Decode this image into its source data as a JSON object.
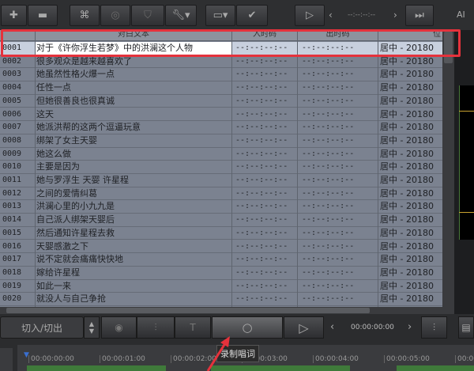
{
  "toolbar": {
    "timecode": "--:--:--:--",
    "buttons": [
      "add",
      "remove",
      "find",
      "zoom",
      "shield",
      "tools",
      "display",
      "check",
      "play",
      "next"
    ],
    "ai_label": "AI"
  },
  "table": {
    "headers": [
      "对白文本",
      "入时码",
      "出时码",
      "位"
    ],
    "rows": [
      {
        "id": "0001",
        "text": "对于《许你浮生若梦》中的洪澜这个人物"
      },
      {
        "id": "0002",
        "text": "很多观众是越来越喜欢了"
      },
      {
        "id": "0003",
        "text": "她虽然性格火爆一点"
      },
      {
        "id": "0004",
        "text": "任性一点"
      },
      {
        "id": "0005",
        "text": "但她很善良也很真诚"
      },
      {
        "id": "0006",
        "text": "这天"
      },
      {
        "id": "0007",
        "text": "她派洪帮的这两个逗逼玩意"
      },
      {
        "id": "0008",
        "text": "绑架了女主天婴"
      },
      {
        "id": "0009",
        "text": "她这么做"
      },
      {
        "id": "0010",
        "text": "主要是因为"
      },
      {
        "id": "0011",
        "text": "她与罗浮生 天婴 许星程"
      },
      {
        "id": "0012",
        "text": "之间的爱情纠葛"
      },
      {
        "id": "0013",
        "text": "洪澜心里的小九九是"
      },
      {
        "id": "0014",
        "text": "自己派人绑架天婴后"
      },
      {
        "id": "0015",
        "text": "然后通知许星程去救"
      },
      {
        "id": "0016",
        "text": "天婴感激之下"
      },
      {
        "id": "0017",
        "text": "说不定就会痛痛快快地"
      },
      {
        "id": "0018",
        "text": "嫁给许星程"
      },
      {
        "id": "0019",
        "text": "如此一来"
      },
      {
        "id": "0020",
        "text": "就没人与自己争抢"
      }
    ],
    "in_time": "--:--:--:--",
    "out_time": "--:--:--:--",
    "position": "居中 - 20180"
  },
  "bottom": {
    "mode": "切入/切出",
    "timecode": "00:00:00:00",
    "tooltip": "录制唱词",
    "ruler": [
      "00:00:00:00",
      "00:00:01:00",
      "00:00:02:00",
      "00:00:03:00",
      "00:00:04:00",
      "00:00:05:00",
      "00:00"
    ]
  },
  "colors": {
    "highlight": "#e5323c",
    "clip": "#3f7a3a"
  }
}
